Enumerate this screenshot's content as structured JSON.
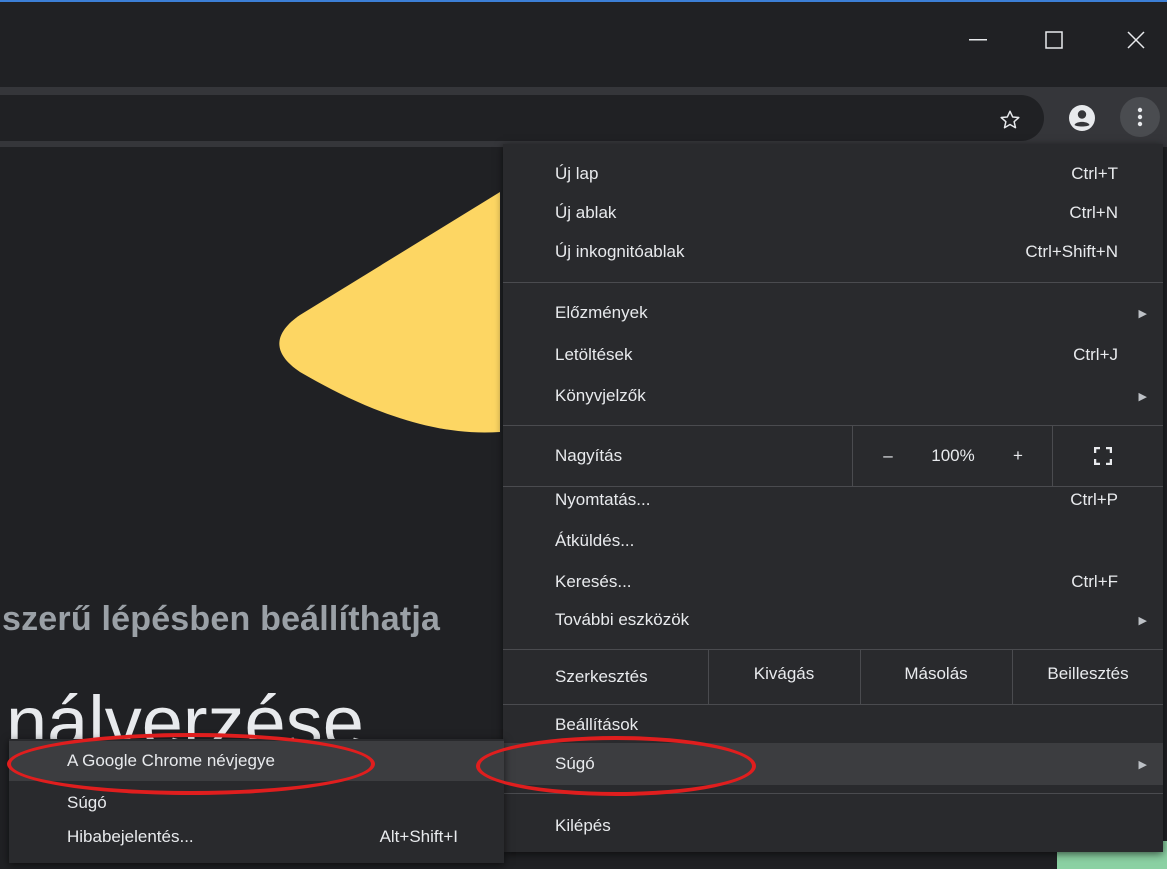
{
  "window": {
    "controls": [
      "minimize-icon",
      "maximize-icon",
      "close-icon"
    ]
  },
  "toolbar": {
    "icons": [
      "star-icon",
      "account-icon",
      "more-vert-icon"
    ]
  },
  "page": {
    "heading": "szerű lépésben beállíthatja",
    "big_text": "nálverzése"
  },
  "menu": {
    "new_tab": {
      "label": "Új lap",
      "shortcut": "Ctrl+T"
    },
    "new_window": {
      "label": "Új ablak",
      "shortcut": "Ctrl+N"
    },
    "incognito": {
      "label": "Új inkognitóablak",
      "shortcut": "Ctrl+Shift+N"
    },
    "history": {
      "label": "Előzmények"
    },
    "downloads": {
      "label": "Letöltések",
      "shortcut": "Ctrl+J"
    },
    "bookmarks": {
      "label": "Könyvjelzők"
    },
    "zoom": {
      "label": "Nagyítás",
      "minus": "–",
      "value": "100%",
      "plus": "+"
    },
    "print": {
      "label": "Nyomtatás...",
      "shortcut": "Ctrl+P"
    },
    "cast": {
      "label": "Átküldés..."
    },
    "find": {
      "label": "Keresés...",
      "shortcut": "Ctrl+F"
    },
    "more_tools": {
      "label": "További eszközök"
    },
    "edit": {
      "label": "Szerkesztés",
      "cut": "Kivágás",
      "copy": "Másolás",
      "paste": "Beillesztés"
    },
    "settings": {
      "label": "Beállítások"
    },
    "help": {
      "label": "Súgó"
    },
    "exit": {
      "label": "Kilépés"
    }
  },
  "submenu": {
    "about": {
      "label": "A Google Chrome névjegye"
    },
    "help": {
      "label": "Súgó"
    },
    "report": {
      "label": "Hibabejelentés...",
      "shortcut": "Alt+Shift+I"
    }
  },
  "colors": {
    "annotation": "#e01e1e",
    "menu_bg": "#292a2d",
    "highlight": "#3c3d40",
    "accent_yellow": "#fdd663",
    "accent_green": "#8bd1a3"
  }
}
